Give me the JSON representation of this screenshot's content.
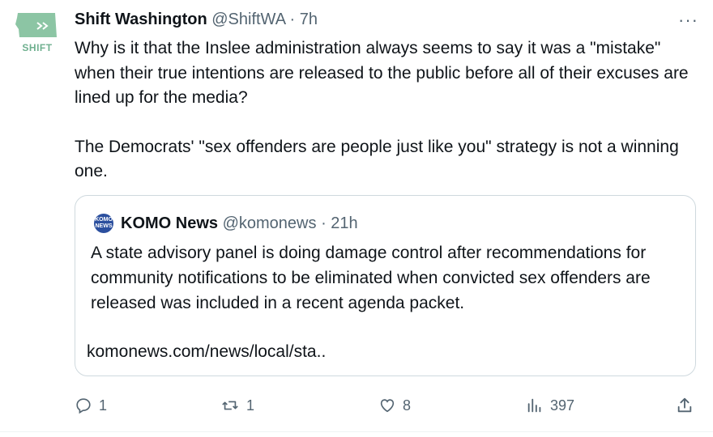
{
  "tweet": {
    "avatar_text": "SHIFT",
    "author_name": "Shift Washington",
    "author_handle": "@ShiftWA",
    "separator": "·",
    "time": "7h",
    "text_paragraph_1": "Why is it that the Inslee administration always seems to say it was a \"mistake\" when their true intentions are released to the public before all of their excuses are lined up for the media?",
    "text_paragraph_2": "The Democrats' \"sex offenders are people just like you\" strategy is not a winning one.",
    "more_label": "···"
  },
  "quote": {
    "avatar_text_1": "KOMO",
    "avatar_text_2": "NEWS",
    "author_name": "KOMO News",
    "author_handle": "@komonews",
    "separator": "·",
    "time": "21h",
    "text": "A state advisory panel is doing damage control after recommendations for community notifications to be eliminated when convicted sex offenders are released was included in a recent agenda packet.",
    "link": "komonews.com/news/local/sta.."
  },
  "actions": {
    "replies": "1",
    "retweets": "1",
    "likes": "8",
    "views": "397"
  },
  "colors": {
    "text": "#0f1419",
    "secondary": "#536471",
    "border": "#cfd9de",
    "avatar_green": "#6fb08f",
    "komo_blue": "#2b4f9e"
  }
}
